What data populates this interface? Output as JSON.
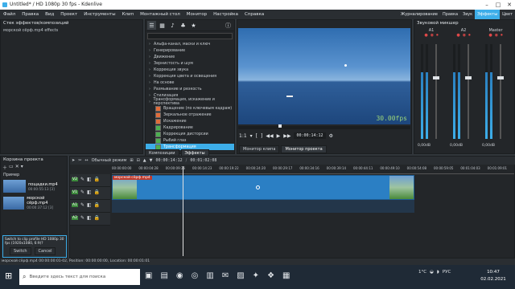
{
  "window": {
    "title": "Untitled* / HD 1080p 30 fps - Kdenlive"
  },
  "menu": [
    "Файл",
    "Правка",
    "Вид",
    "Проект",
    "Инструменты",
    "Клип",
    "Монтажный стол",
    "Монитор",
    "Настройка",
    "Справка"
  ],
  "layouts": [
    "Журналирование",
    "Правка",
    "Звук",
    "Эффекты",
    "Цвет"
  ],
  "layouts_active_index": 3,
  "effect_stack": {
    "title": "Стек эффектов/композиций",
    "item": "морской сёрф.mp4 effects"
  },
  "effects_list": [
    {
      "label": "Альфа-канал, маски и ключ",
      "selected": false,
      "icon": false
    },
    {
      "label": "Генерирование",
      "selected": false,
      "icon": false
    },
    {
      "label": "Движение",
      "selected": false,
      "icon": false
    },
    {
      "label": "Зернистость и шум",
      "selected": false,
      "icon": false
    },
    {
      "label": "Коррекция звука",
      "selected": false,
      "icon": false
    },
    {
      "label": "Коррекция цвета и освещения",
      "selected": false,
      "icon": false
    },
    {
      "label": "На основе",
      "selected": false,
      "icon": false
    },
    {
      "label": "Размывание и резкость",
      "selected": false,
      "icon": false
    },
    {
      "label": "Стилизация",
      "selected": false,
      "icon": false
    },
    {
      "label": "Трансформация, искажение и перспектива",
      "selected": false,
      "icon": false
    },
    {
      "label": "Вращение (по ключевым кадрам)",
      "selected": false,
      "icon": true,
      "color": "#e06c3a"
    },
    {
      "label": "Зеркальное отражение",
      "selected": false,
      "icon": true,
      "color": "#e06c3a"
    },
    {
      "label": "Искажение",
      "selected": false,
      "icon": true,
      "color": "#e06c3a"
    },
    {
      "label": "Кадрирование",
      "selected": false,
      "icon": true,
      "color": "#4caf50"
    },
    {
      "label": "Коррекция дисторсии",
      "selected": false,
      "icon": true,
      "color": "#4caf50"
    },
    {
      "label": "Рыбий глаз",
      "selected": false,
      "icon": true,
      "color": "#4caf50"
    },
    {
      "label": "Трансформация",
      "selected": true,
      "icon": true,
      "color": "#4caf50"
    },
    {
      "label": "Устаревшие",
      "selected": false,
      "icon": false
    },
    {
      "label": "Утилиты",
      "selected": false,
      "icon": false
    }
  ],
  "effects_tabs": [
    "Композиции",
    "Эффекты"
  ],
  "monitor": {
    "timecode": "00:00:14:12",
    "fps_label": "30.00fps",
    "zoom": "1:1",
    "tabs": [
      "Монитор клипа",
      "Монитор проекта"
    ]
  },
  "mixer": {
    "title": "Звуковой микшер",
    "channels": [
      {
        "name": "A1",
        "value": "0,00dB"
      },
      {
        "name": "A2",
        "value": "0,00dB"
      },
      {
        "name": "Master",
        "value": "0,00dB"
      }
    ]
  },
  "bin": {
    "title": "Корзина проекта",
    "column": "Пример",
    "items": [
      {
        "name": "пощадки.mp4",
        "duration": "00:00:55:13 [3]"
      },
      {
        "name": "морской сёрф.mp4",
        "duration": "00:00:37:12 [3]"
      }
    ]
  },
  "notice": {
    "text": "Switch to clip profile HD 1080p 30 fps (1920x1080, 6:9)?",
    "switch": "Switch",
    "cancel": "Cancel"
  },
  "timeline": {
    "mode": "Обычный режим",
    "timecode": "00:00:14:12",
    "duration": "00:01:02:08",
    "ticks": [
      "00:00:00:00",
      "00:00:04:28",
      "00:00:09:26",
      "00:00:14:23",
      "00:00:19:22",
      "00:00:24:20",
      "00:00:29:17",
      "00:00:34:16",
      "00:00:39:14",
      "00:00:44:11",
      "00:00:49:10",
      "00:00:54:08",
      "00:00:59:05",
      "00:01:04:03",
      "00:01:09:01"
    ],
    "clip_label": "морской сёрф.mp4",
    "tracks": [
      "V2",
      "V1",
      "A1",
      "A2"
    ]
  },
  "status": {
    "text": "морской сёрф.mp4 00:00:00:01-02, Position: 00:00:00:00, Location: 00:00:01:01"
  },
  "taskbar": {
    "search_placeholder": "Введите здесь текст для поиска",
    "temp": "1°C",
    "time": "10:47",
    "date": "02.02.2021",
    "lang": "РУС"
  }
}
